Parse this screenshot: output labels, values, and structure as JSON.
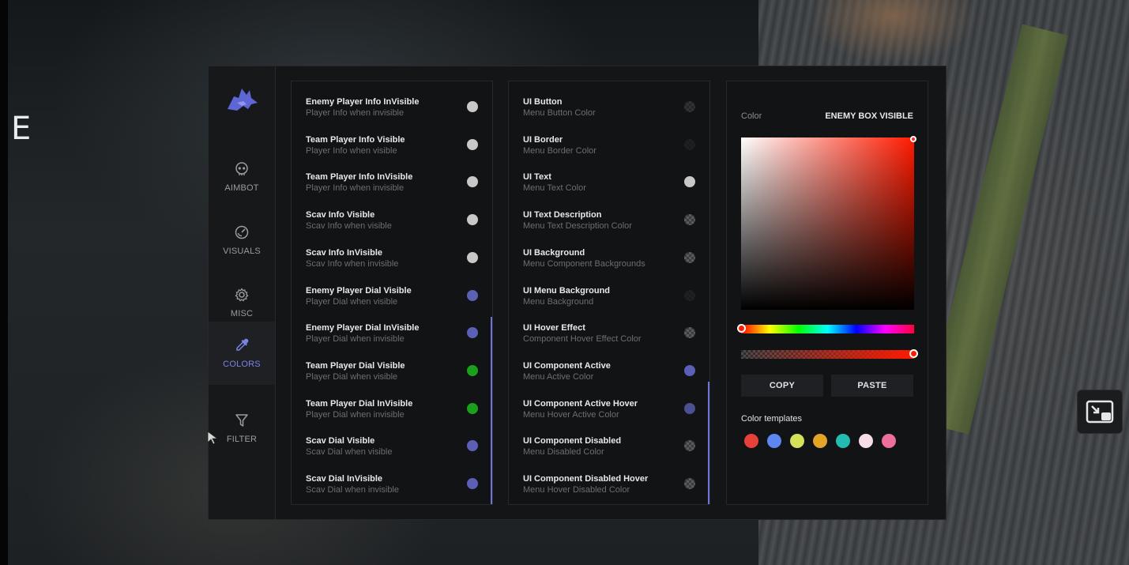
{
  "background": {
    "partial_heading": "E"
  },
  "nav": {
    "items": [
      {
        "label": "AIMBOT",
        "icon": "skull-icon",
        "active": false
      },
      {
        "label": "VISUALS",
        "icon": "target-icon",
        "active": false
      },
      {
        "label": "MISC",
        "icon": "gear-icon",
        "active": false
      },
      {
        "label": "COLORS",
        "icon": "eyedropper-icon",
        "active": true
      },
      {
        "label": "FILTER",
        "icon": "filter-icon",
        "active": false
      }
    ],
    "active_color": "#7b83e6"
  },
  "player_colors": [
    {
      "title": "Enemy Player Info InVisible",
      "desc": "Player Info when invisible",
      "color": "#c8c8c8"
    },
    {
      "title": "Team Player Info Visible",
      "desc": "Player Info when visible",
      "color": "#c8c8c8"
    },
    {
      "title": "Team Player Info InVisible",
      "desc": "Player Info when invisible",
      "color": "#c8c8c8"
    },
    {
      "title": "Scav Info Visible",
      "desc": "Scav Info when visible",
      "color": "#c8c8c8"
    },
    {
      "title": "Scav Info InVisible",
      "desc": "Scav Info when invisible",
      "color": "#c8c8c8"
    },
    {
      "title": "Enemy Player Dial Visible",
      "desc": "Player Dial when visible",
      "color": "#5b5fb5"
    },
    {
      "title": "Enemy Player Dial InVisible",
      "desc": "Player Dial when invisible",
      "color": "#5b5fb5"
    },
    {
      "title": "Team Player Dial Visible",
      "desc": "Player Dial when visible",
      "color": "#1aa01a"
    },
    {
      "title": "Team Player Dial InVisible",
      "desc": "Player Dial when invisible",
      "color": "#1aa01a"
    },
    {
      "title": "Scav Dial Visible",
      "desc": "Scav Dial when visible",
      "color": "#5b5fb5"
    },
    {
      "title": "Scav Dial InVisible",
      "desc": "Scav Dial when invisible",
      "color": "#5b5fb5"
    }
  ],
  "ui_colors": [
    {
      "title": "UI Button",
      "desc": "Menu Button Color",
      "color": "checker-dim"
    },
    {
      "title": "UI Border",
      "desc": "Menu Border Color",
      "color": "checker-faint"
    },
    {
      "title": "UI Text",
      "desc": "Menu Text Color",
      "color": "#c8c8c8"
    },
    {
      "title": "UI Text Description",
      "desc": "Menu Text Description Color",
      "color": "checker"
    },
    {
      "title": "UI Background",
      "desc": "Menu Component Backgrounds",
      "color": "checker"
    },
    {
      "title": "UI Menu Background",
      "desc": "Menu Background",
      "color": "checker-faint"
    },
    {
      "title": "UI Hover Effect",
      "desc": "Component Hover Effect Color",
      "color": "checker"
    },
    {
      "title": "UI Component Active",
      "desc": "Menu Active Color",
      "color": "#5b5fb5"
    },
    {
      "title": "UI Component Active Hover",
      "desc": "Menu Hover Active Color",
      "color": "#4c4f90"
    },
    {
      "title": "UI Component Disabled",
      "desc": "Menu Disabled Color",
      "color": "checker"
    },
    {
      "title": "UI Component Disabled Hover",
      "desc": "Menu Hover Disabled Color",
      "color": "checker"
    }
  ],
  "picker": {
    "label": "Color",
    "target": "ENEMY BOX VISIBLE",
    "selected_color": "#ff1a00",
    "copy_label": "COPY",
    "paste_label": "PASTE",
    "templates_label": "Color templates",
    "templates": [
      "#e8413a",
      "#5d86f0",
      "#d4e25a",
      "#e4a428",
      "#22bdb0",
      "#f6dde6",
      "#ee6f9c"
    ]
  }
}
